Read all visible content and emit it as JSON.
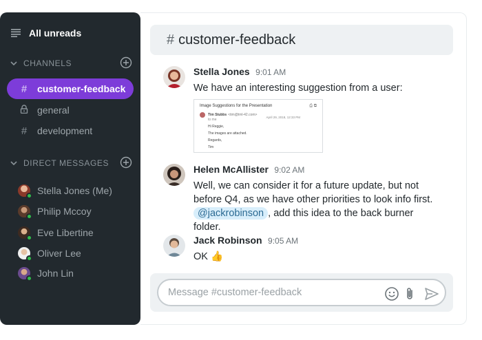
{
  "sidebar": {
    "title": "All unreads",
    "channels_heading": "CHANNELS",
    "channels": [
      {
        "label": "customer-feedback",
        "active": true,
        "icon": "hash-icon"
      },
      {
        "label": "general",
        "active": false,
        "icon": "lock-icon"
      },
      {
        "label": "development",
        "active": false,
        "icon": "hash-icon"
      }
    ],
    "dm_heading": "DIRECT MESSAGES",
    "direct_messages": [
      {
        "label": "Stella Jones (Me)"
      },
      {
        "label": "Philip Mccoy"
      },
      {
        "label": "Eve Libertine"
      },
      {
        "label": "Oliver Lee"
      },
      {
        "label": "John Lin"
      }
    ]
  },
  "channel": {
    "hash": "#",
    "name": "customer-feedback"
  },
  "messages": [
    {
      "author": "Stella Jones",
      "time": "9:01 AM",
      "text": "We have an interesting suggestion from a user:"
    },
    {
      "author": "Helen McAllister",
      "time": "9:02 AM",
      "text_before": "Well, we can consider it for a future update, but not before Q4, as we have other priorities to look info first.",
      "mention": "@jackrobinson",
      "text_after": ", add this idea to the back burner folder."
    },
    {
      "author": "Jack Robinson",
      "time": "9:05 AM",
      "text": "OK 👍"
    }
  ],
  "attachment": {
    "title": "Image Suggestions for the Presentation",
    "sender": "Tim Stubbs",
    "sender_email": "<tim@tml-42.com>",
    "to": "to me",
    "date": "April 29, 2018, 12:33 PM",
    "lines": [
      "Hi Reggie,",
      "The images are attached.",
      "Regards,",
      "Tim"
    ]
  },
  "composer": {
    "placeholder": "Message #customer-feedback"
  },
  "colors": {
    "sidebar_bg": "#22292e",
    "active_channel": "#7d3cd9",
    "presence_online": "#2fbf4c",
    "mention_bg": "#d8eefb"
  }
}
